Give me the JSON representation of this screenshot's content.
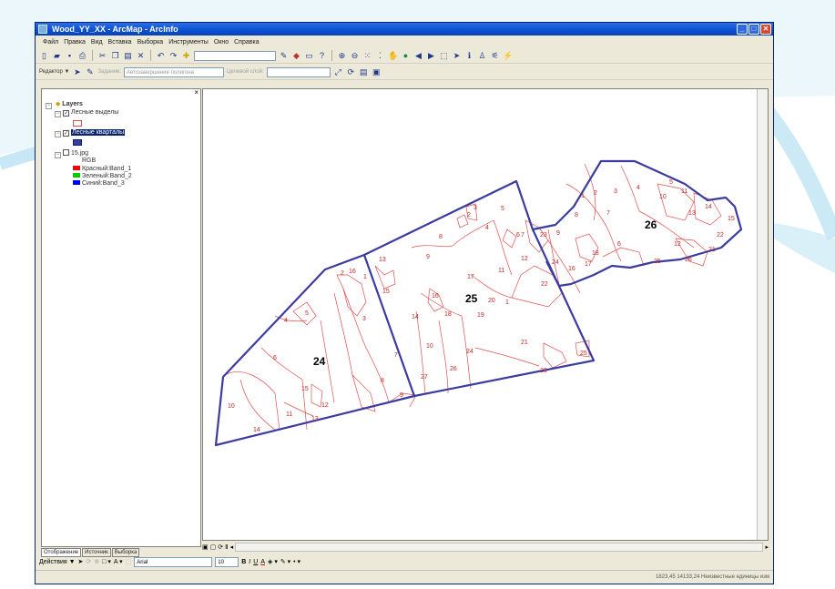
{
  "window": {
    "title": "Wood_YY_XX - ArcMap - ArcInfo"
  },
  "menu": [
    "Файл",
    "Правка",
    "Вид",
    "Вставка",
    "Выборка",
    "Инструменты",
    "Окно",
    "Справка"
  ],
  "toolbar2": {
    "editor_label": "Редактор ▼",
    "task_label": "Задание:",
    "task_value": "Автозавершение полигона",
    "target_label": "Целевой слой:"
  },
  "toc": {
    "root": "Layers",
    "layers": [
      {
        "label": "Лесные выделы",
        "checked": true
      },
      {
        "label": "Лесные кварталы",
        "checked": true
      },
      {
        "label": "15.jpg",
        "checked": false
      }
    ],
    "rgb_label": "RGB",
    "bands": [
      {
        "label": "Красный:Band_1",
        "color": "#ff0000"
      },
      {
        "label": "Зеленый:Band_2",
        "color": "#00cc00"
      },
      {
        "label": "Синий:Band_3",
        "color": "#0000ff"
      }
    ]
  },
  "toc_tabs": [
    "Отображение",
    "Источник",
    "Выборка"
  ],
  "draw_toolbar": {
    "actions_label": "Действия ▼",
    "font": "Arial",
    "size": "10",
    "bold": "B",
    "italic": "I",
    "underline": "U",
    "font_color": "A"
  },
  "map": {
    "quarter_numbers": [
      "24",
      "25",
      "26"
    ],
    "polygon_labels": {
      "q24": [
        "1",
        "2",
        "16",
        "3",
        "4",
        "5",
        "6",
        "7",
        "8",
        "9",
        "10",
        "11",
        "12",
        "13",
        "14",
        "15"
      ],
      "q25": [
        "1",
        "2",
        "3",
        "4",
        "5",
        "6",
        "7",
        "8",
        "9",
        "10",
        "11",
        "12",
        "13",
        "14",
        "15",
        "16",
        "17",
        "18",
        "19",
        "20",
        "21",
        "22",
        "23",
        "24",
        "25",
        "26",
        "27"
      ],
      "q26": [
        "1",
        "2",
        "3",
        "4",
        "5",
        "6",
        "7",
        "8",
        "9",
        "10",
        "11",
        "12",
        "13",
        "14",
        "15",
        "16",
        "17",
        "18",
        "21",
        "22",
        "23",
        "24",
        "25",
        "26"
      ]
    },
    "colors": {
      "quarter_border": "#3b3ba0",
      "polygon_border": "#e05050"
    }
  },
  "status": {
    "coords": "1823,45  14133,24 Неизвестные единицы изм"
  }
}
